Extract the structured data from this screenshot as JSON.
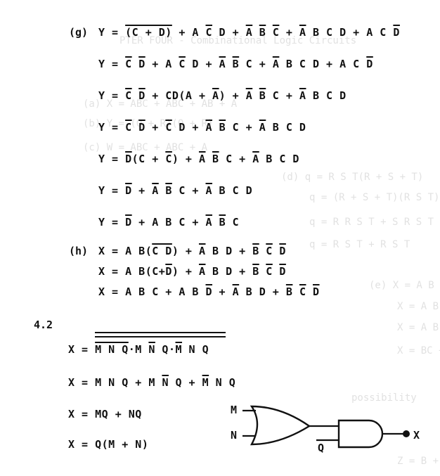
{
  "section_g": {
    "label": "(g)",
    "lines": [
      [
        "Y = ",
        {
          "o": "(C + D)"
        },
        " + A ",
        {
          "o": "C"
        },
        " D + ",
        {
          "o": "A"
        },
        " ",
        {
          "o": "B"
        },
        " ",
        {
          "o": "C"
        },
        " + ",
        {
          "o": "A"
        },
        " B C D + A C ",
        {
          "o": "D"
        }
      ],
      [
        "Y = ",
        {
          "o": "C"
        },
        " ",
        {
          "o": "D"
        },
        " + A ",
        {
          "o": "C"
        },
        " D + ",
        {
          "o": "A"
        },
        " ",
        {
          "o": "B"
        },
        " C + ",
        {
          "o": "A"
        },
        " B C D + A C ",
        {
          "o": "D"
        }
      ],
      [
        "Y = ",
        {
          "o": "C"
        },
        " ",
        {
          "o": "D"
        },
        " + CD(A + ",
        {
          "o": "A"
        },
        ") + ",
        {
          "o": "A"
        },
        " ",
        {
          "o": "B"
        },
        " C + ",
        {
          "o": "A"
        },
        " B C D"
      ],
      [
        "Y = ",
        {
          "o": "C"
        },
        " ",
        {
          "o": "D"
        },
        " + ",
        {
          "o": "C"
        },
        " D + ",
        {
          "o": "A"
        },
        " ",
        {
          "o": "B"
        },
        " C + ",
        {
          "o": "A"
        },
        " B C D"
      ],
      [
        "Y = ",
        {
          "o": "D"
        },
        "(C + ",
        {
          "o": "C"
        },
        ") + ",
        {
          "o": "A"
        },
        " ",
        {
          "o": "B"
        },
        " C + ",
        {
          "o": "A"
        },
        " B C D"
      ],
      [
        "Y = ",
        {
          "o": "D"
        },
        " + ",
        {
          "o": "A"
        },
        " ",
        {
          "o": "B"
        },
        " C + ",
        {
          "o": "A"
        },
        " B C D"
      ],
      [
        "Y = ",
        {
          "o": "D"
        },
        " + A B C + ",
        {
          "o": "A"
        },
        " ",
        {
          "o": "B"
        },
        " C"
      ]
    ]
  },
  "section_h": {
    "label": "(h)",
    "lines": [
      [
        "X = A B(",
        {
          "o": "C D"
        },
        ") + ",
        {
          "o": "A"
        },
        " B D + ",
        {
          "o": "B"
        },
        " ",
        {
          "o": "C"
        },
        " ",
        {
          "o": "D"
        }
      ],
      [
        "X = A B(C+",
        {
          "o": "D"
        },
        ") + ",
        {
          "o": "A"
        },
        " B D + ",
        {
          "o": "B"
        },
        " ",
        {
          "o": "C"
        },
        " ",
        {
          "o": "D"
        }
      ],
      [
        "X = A B C + A B ",
        {
          "o": "D"
        },
        " + ",
        {
          "o": "A"
        },
        " B D + ",
        {
          "o": "B"
        },
        " ",
        {
          "o": "C"
        },
        " ",
        {
          "o": "D"
        }
      ]
    ]
  },
  "section_42": {
    "label": "4.2",
    "lines": [
      [
        "X = ",
        {
          "o": "M N Q"
        },
        "·M ",
        {
          "o": "N"
        },
        " Q·",
        {
          "o": "M"
        },
        " N Q"
      ],
      [
        "X = M N Q + M ",
        {
          "o": "N"
        },
        " Q + ",
        {
          "o": "M"
        },
        " N Q"
      ],
      [
        "X = MQ + NQ"
      ],
      [
        "X = Q(M + N)"
      ]
    ]
  },
  "gate": {
    "input_m": "M",
    "input_n": "N",
    "input_q": "Q",
    "output_x": "X"
  },
  "bleed": [
    "PTER FOUR - Combinational Logic Circuits",
    "(a) X = ABC + ABC + AB + A",
    "(b) Y = (Q + R)(Q + R)",
    "(c) W = ABC + ABC + A",
    "(d) q = R S T(R + S + T)",
    "q = (R + S + T)(R S T)",
    "q = R R S T + S R S T",
    "q = R S T + R S T",
    "(e) X = A B C + A B C",
    "X = A B C + BC(A + A)",
    "X = A B C + BC + AB",
    "X = BC + B(A C + A)",
    "possibility",
    "Z = B + B C + B C"
  ]
}
